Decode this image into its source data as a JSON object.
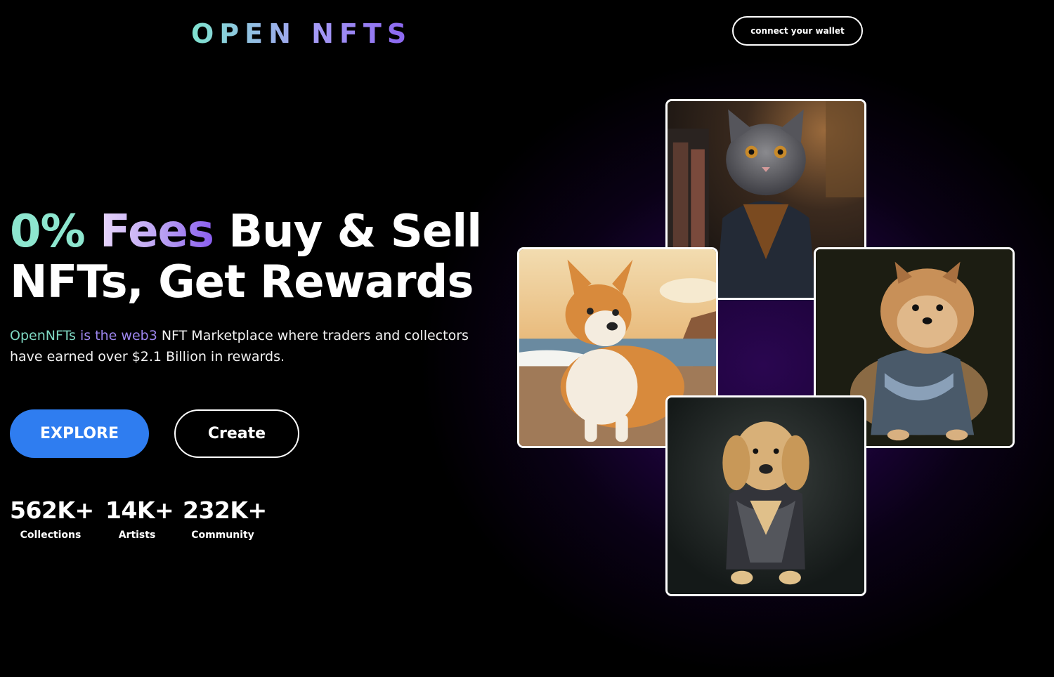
{
  "brand": {
    "logo_text": "OPEN NFTS"
  },
  "header": {
    "connect_wallet_label": "connect your wallet"
  },
  "hero": {
    "headline_zero": "0%",
    "headline_fees": "Fees",
    "headline_rest_line1": "Buy & Sell",
    "headline_line2": "NFTs, Get Rewards",
    "description_part1": "OpenNFTs",
    "description_part2": "is the web3",
    "description_part3": "NFT Marketplace where traders and collectors have earned over $2.1 Billion in rewards.",
    "explore_label": "EXPLORE",
    "create_label": "Create"
  },
  "stats": [
    {
      "value": "562K+",
      "label": "Collections"
    },
    {
      "value": "14K+",
      "label": "Artists"
    },
    {
      "value": "232K+",
      "label": "Community"
    }
  ],
  "gallery": [
    {
      "name": "cat-in-jacket"
    },
    {
      "name": "corgi-on-beach"
    },
    {
      "name": "pomeranian-in-sweater"
    },
    {
      "name": "golden-retriever-in-jacket"
    }
  ],
  "colors": {
    "background": "#000000",
    "accent_teal": "#8de6cf",
    "accent_purple": "#8a5df0",
    "button_blue": "#2f7df0"
  }
}
